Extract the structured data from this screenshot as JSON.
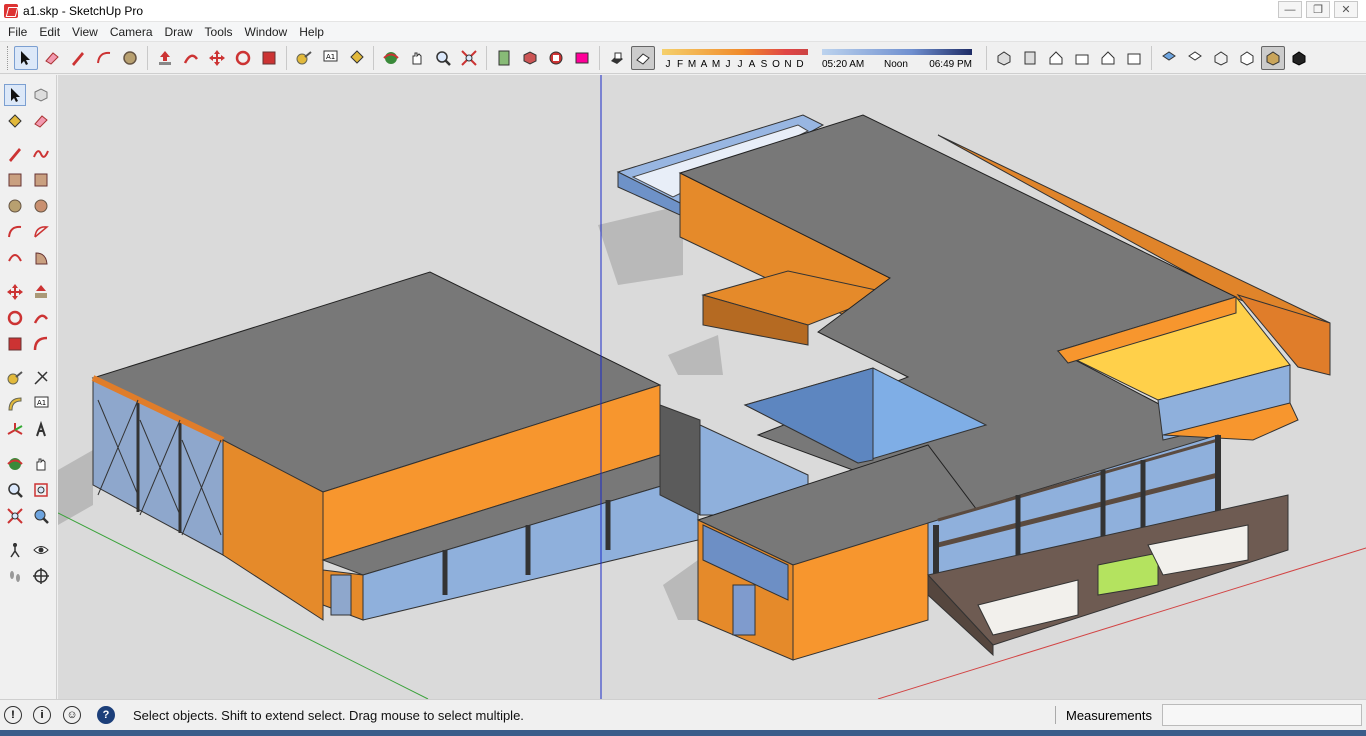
{
  "window": {
    "title": "a1.skp - SketchUp Pro"
  },
  "menu": [
    "File",
    "Edit",
    "View",
    "Camera",
    "Draw",
    "Tools",
    "Window",
    "Help"
  ],
  "toolbar": {
    "months": [
      "J",
      "F",
      "M",
      "A",
      "M",
      "J",
      "J",
      "A",
      "S",
      "O",
      "N",
      "D"
    ],
    "time_start": "05:20 AM",
    "time_mid": "Noon",
    "time_end": "06:49 PM"
  },
  "status": {
    "message": "Select objects. Shift to extend select. Drag mouse to select multiple.",
    "measurements_label": "Measurements",
    "measurements_value": ""
  },
  "colors": {
    "roof": "#787878",
    "orange_wall": "#f7962e",
    "glass": "#7f9fd0",
    "ground": "#dadada",
    "highlight_yellow": "#ffd04a",
    "axis_blue": "#1a2ac8",
    "axis_red": "#d24444",
    "axis_green": "#3aa23a"
  },
  "icons": {
    "select": "arrow-icon",
    "eraser": "eraser-icon",
    "pencil": "pencil-icon",
    "arc": "arc-icon",
    "circle": "circle-icon",
    "push_pull": "push-pull-icon",
    "follow_me": "follow-me-icon",
    "move": "move-icon",
    "rotate": "rotate-icon",
    "scale": "scale-icon",
    "tape": "tape-measure-icon",
    "text": "text-icon",
    "paint": "paint-bucket-icon",
    "orbit": "orbit-icon",
    "pan": "pan-icon",
    "zoom": "zoom-icon",
    "zoom_extents": "zoom-extents-icon"
  }
}
